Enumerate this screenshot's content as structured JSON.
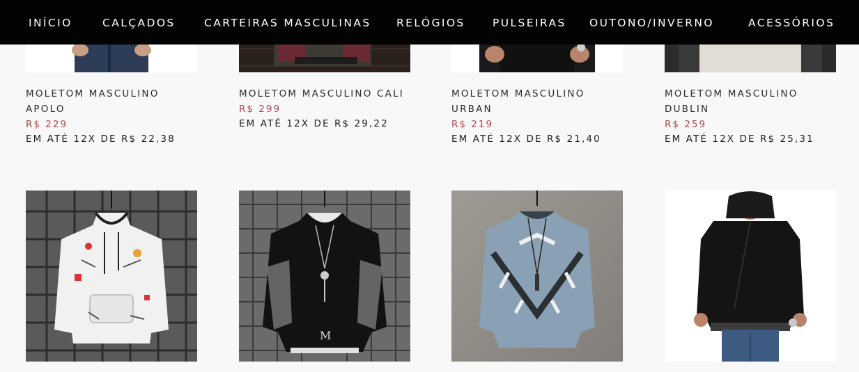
{
  "nav": {
    "items": [
      {
        "label": "INÍCIO"
      },
      {
        "label": "CALÇADOS"
      },
      {
        "label": "CARTEIRAS MASCULINAS"
      },
      {
        "label": "RELÓGIOS"
      },
      {
        "label": "PULSEIRAS"
      },
      {
        "label": "OUTONO/INVERNO"
      },
      {
        "label": "ACESSÓRIOS"
      }
    ]
  },
  "products_row1": [
    {
      "name_line1": "MOLETOM MASCULINO",
      "name_line2": "APOLO",
      "price": "R$ 229",
      "installments": "EM ATÉ 12X DE R$ 22,38"
    },
    {
      "name_line1": "MOLETOM MASCULINO CALI",
      "name_line2": "",
      "price": "R$ 299",
      "installments": "EM ATÉ 12X DE R$ 29,22"
    },
    {
      "name_line1": "MOLETOM MASCULINO",
      "name_line2": "URBAN",
      "price": "R$ 219",
      "installments": "EM ATÉ 12X DE R$ 21,40"
    },
    {
      "name_line1": "MOLETOM MASCULINO",
      "name_line2": "DUBLIN",
      "price": "R$ 259",
      "installments": "EM ATÉ 12X DE R$ 25,31"
    }
  ],
  "products_row2_images": [
    {
      "icon": "white-graffiti-hoodie-image"
    },
    {
      "icon": "black-sweatshirt-necklace-image"
    },
    {
      "icon": "blue-v-sweatshirt-image"
    },
    {
      "icon": "black-zip-hoodie-model-image"
    }
  ],
  "colors": {
    "nav_bg": "#030303",
    "nav_text": "#ffffff",
    "page_bg": "#f8f8f8",
    "price": "#b0474e",
    "text": "#222222"
  }
}
